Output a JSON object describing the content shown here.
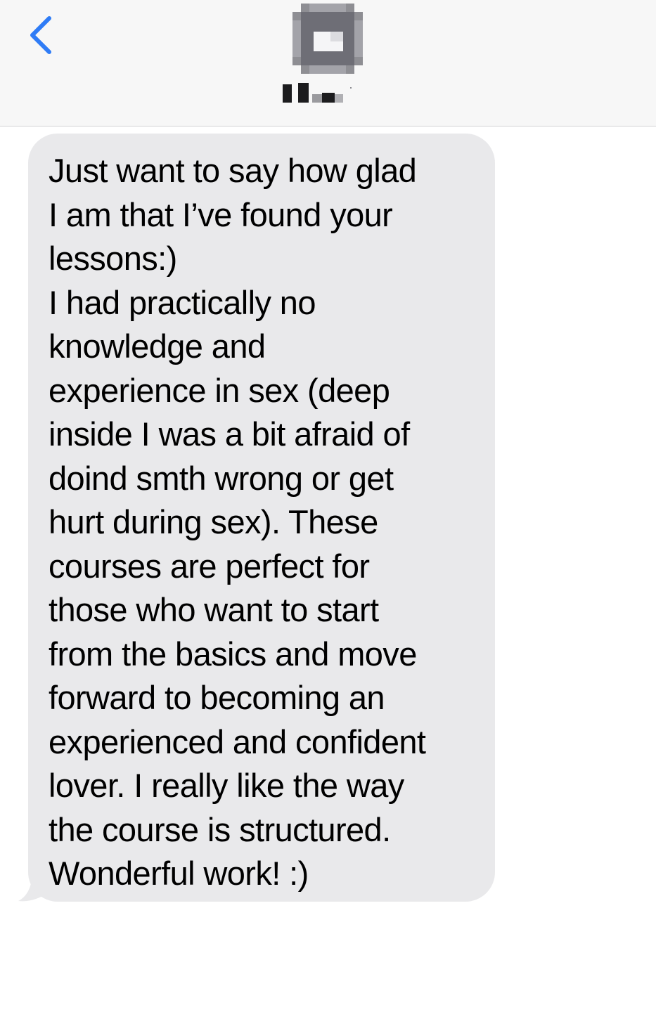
{
  "header": {
    "back_icon": "chevron-left-icon",
    "avatar_icon": "person-avatar-icon (pixelated)",
    "contact_name_obscured": true,
    "accent_color": "#2f7cf6",
    "background_color": "#f7f7f7"
  },
  "conversation": {
    "incoming_bubble_color": "#e9e9eb",
    "messages": [
      {
        "direction": "incoming",
        "lines": [
          "Just want to say how glad",
          "I am that I’ve found your",
          "lessons:)",
          "I had practically no",
          "knowledge and",
          "experience in sex (deep",
          "inside I was a bit afraid of",
          "doind smth wrong or get",
          "hurt during sex). These",
          "courses are perfect for",
          "those who want to start",
          "from the basics and move",
          "forward to becoming an",
          "experienced and confident",
          "lover. I really like the way",
          "the course is structured.",
          "Wonderful work! :)"
        ]
      }
    ]
  }
}
